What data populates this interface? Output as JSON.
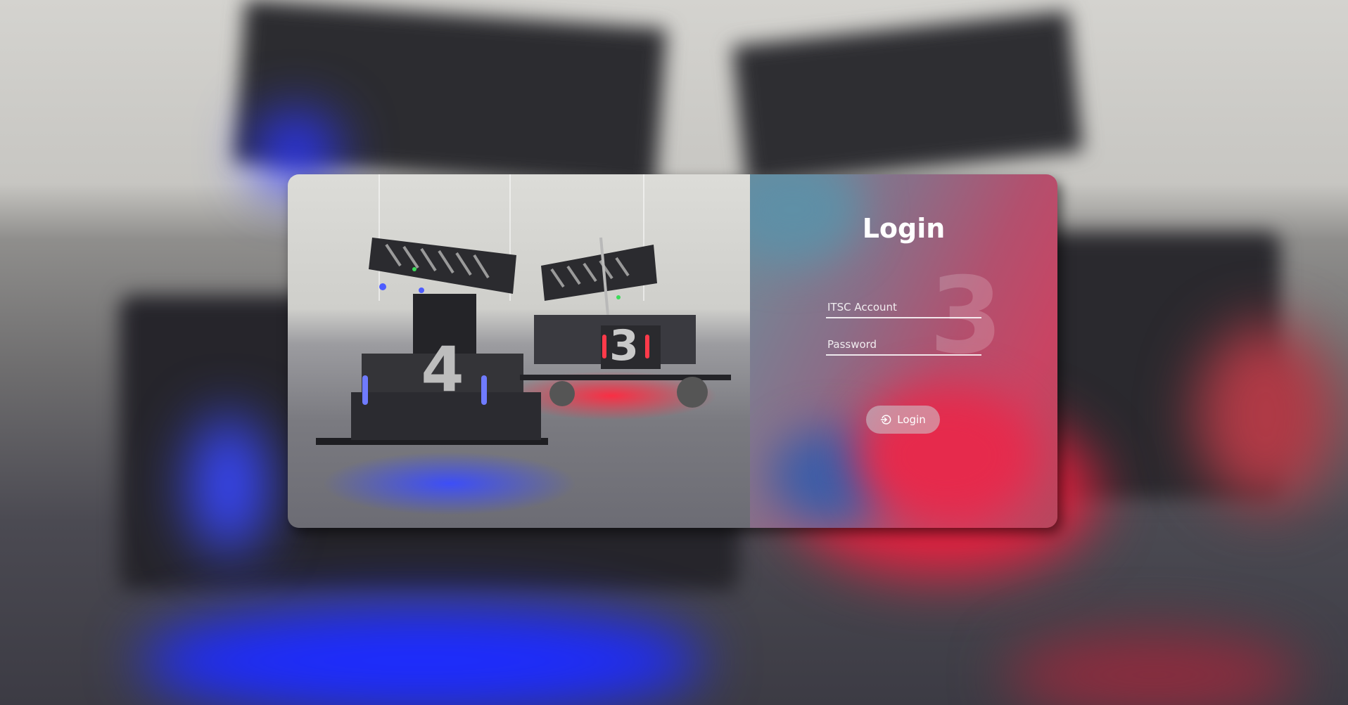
{
  "login": {
    "title": "Login",
    "account_placeholder": "ITSC Account",
    "password_placeholder": "Password",
    "button_label": "Login",
    "button_icon": "login-icon"
  },
  "photo": {
    "robots": [
      {
        "number": "4",
        "accent": "#2a3bff"
      },
      {
        "number": "3",
        "accent": "#ff1e3c"
      }
    ]
  }
}
